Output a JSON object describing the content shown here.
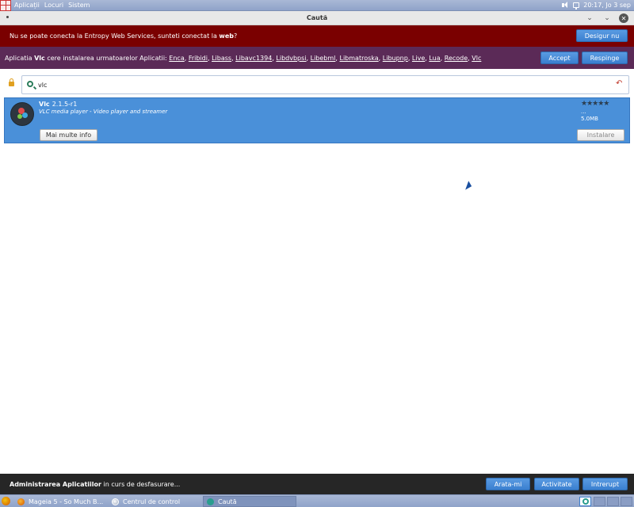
{
  "top_panel": {
    "menus": [
      "Aplicații",
      "Locuri",
      "Sistem"
    ],
    "clock": "20:17, Jo  3 sep"
  },
  "window": {
    "title": "Caută"
  },
  "error_banner": {
    "message_prefix": "Nu se poate conecta la Entropy Web Services, sunteti conectat la ",
    "message_bold": "web",
    "message_suffix": "?",
    "dismiss_label": "Desigur nu"
  },
  "dependency_banner": {
    "prefix": "Aplicatia ",
    "app": "Vlc",
    "middle": " cere instalarea urmatoarelor Aplicatii: ",
    "dependencies": [
      "Enca",
      "Fribidi",
      "Libass",
      "Libavc1394",
      "Libdvbpsi",
      "Libebml",
      "Libmatroska",
      "Libupnp",
      "Live",
      "Lua",
      "Recode",
      "Vlc"
    ],
    "accept_label": "Accept",
    "reject_label": "Respinge"
  },
  "search": {
    "value": "vlc"
  },
  "result": {
    "name": "Vlc",
    "version": "2.1.5-r1",
    "description": "VLC media player - Video player and streamer",
    "rating_stars": "★★★★★",
    "rating_count": "...",
    "size": "5.0MB",
    "more_info_label": "Mai multe info",
    "install_label": "Instalare"
  },
  "status_bar": {
    "bold": "Administrarea Aplicatiilor",
    "text": " in curs de desfasurare...",
    "show_label": "Arata-mi",
    "activity_label": "Activitate",
    "interrupt_label": "Intrerupt"
  },
  "taskbar": {
    "tasks": [
      "Mageia 5 - So Much B...",
      "Centrul de control",
      "Caută"
    ]
  }
}
